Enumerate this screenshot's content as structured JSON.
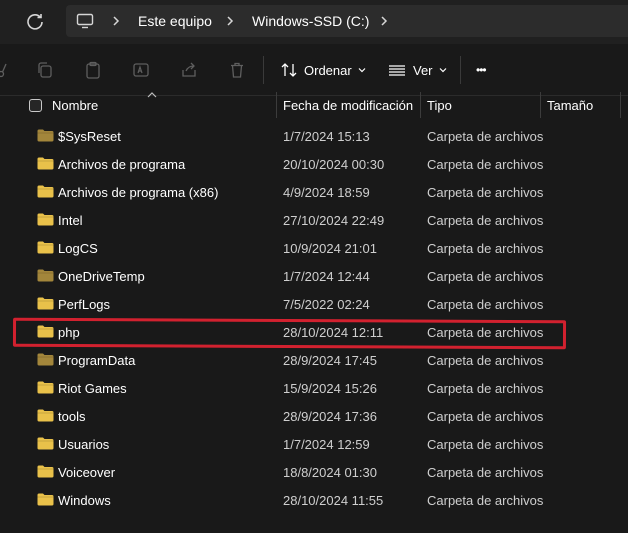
{
  "address_bar": {
    "pc_icon": "computer-icon",
    "crumbs": [
      "Este equipo",
      "Windows-SSD (C:)"
    ]
  },
  "toolbar": {
    "sort_label": "Ordenar",
    "view_label": "Ver",
    "more_label": "•••"
  },
  "columns": {
    "name": "Nombre",
    "date": "Fecha de modificación",
    "type": "Tipo",
    "size": "Tamaño"
  },
  "files": [
    {
      "name": "$SysReset",
      "date": "1/7/2024 15:13",
      "type": "Carpeta de archivos",
      "dim": true
    },
    {
      "name": "Archivos de programa",
      "date": "20/10/2024 00:30",
      "type": "Carpeta de archivos",
      "dim": false
    },
    {
      "name": "Archivos de programa (x86)",
      "date": "4/9/2024 18:59",
      "type": "Carpeta de archivos",
      "dim": false
    },
    {
      "name": "Intel",
      "date": "27/10/2024 22:49",
      "type": "Carpeta de archivos",
      "dim": false
    },
    {
      "name": "LogCS",
      "date": "10/9/2024 21:01",
      "type": "Carpeta de archivos",
      "dim": false
    },
    {
      "name": "OneDriveTemp",
      "date": "1/7/2024 12:44",
      "type": "Carpeta de archivos",
      "dim": true
    },
    {
      "name": "PerfLogs",
      "date": "7/5/2022 02:24",
      "type": "Carpeta de archivos",
      "dim": false
    },
    {
      "name": "php",
      "date": "28/10/2024 12:11",
      "type": "Carpeta de archivos",
      "dim": false
    },
    {
      "name": "ProgramData",
      "date": "28/9/2024 17:45",
      "type": "Carpeta de archivos",
      "dim": true
    },
    {
      "name": "Riot Games",
      "date": "15/9/2024 15:26",
      "type": "Carpeta de archivos",
      "dim": false
    },
    {
      "name": "tools",
      "date": "28/9/2024 17:36",
      "type": "Carpeta de archivos",
      "dim": false
    },
    {
      "name": "Usuarios",
      "date": "1/7/2024 12:59",
      "type": "Carpeta de archivos",
      "dim": false
    },
    {
      "name": "Voiceover",
      "date": "18/8/2024 01:30",
      "type": "Carpeta de archivos",
      "dim": false
    },
    {
      "name": "Windows",
      "date": "28/10/2024 11:55",
      "type": "Carpeta de archivos",
      "dim": false
    }
  ],
  "colors": {
    "folder": "#e9c14a",
    "folder_dim": "#a3863b",
    "highlight": "#d2212f"
  }
}
